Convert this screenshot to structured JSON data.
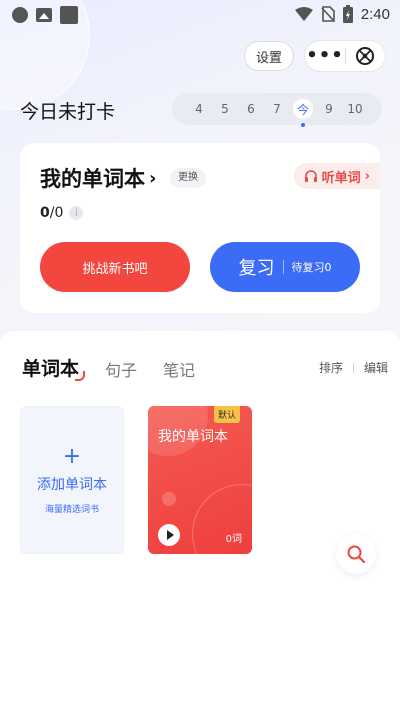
{
  "status_bar": {
    "time": "2:40",
    "left_icons": [
      "circle-icon",
      "image-icon",
      "square-icon"
    ],
    "right_icons": [
      "wifi-icon",
      "no-sim-icon",
      "battery-charging-icon"
    ]
  },
  "header": {
    "settings_label": "设置",
    "more_icon": "more-dots-icon",
    "close_icon": "close-circle-icon"
  },
  "checkin": {
    "title": "今日未打卡",
    "days": [
      "4",
      "5",
      "6",
      "7",
      "今",
      "9",
      "10"
    ],
    "today_index": 4
  },
  "wordbook_card": {
    "title": "我的单词本",
    "change_label": "更换",
    "listen_label": "听单词",
    "learned": "0",
    "total": "/0",
    "challenge_label": "挑战新书吧",
    "review_label": "复习",
    "review_pending": "待复习0"
  },
  "tabs": {
    "items": [
      "单词本",
      "句子",
      "笔记"
    ],
    "active_index": 0,
    "sort_label": "排序",
    "edit_label": "编辑"
  },
  "books": {
    "add_label": "添加单词本",
    "add_sub": "海量精选词书",
    "default_badge": "默认",
    "book_name": "我的单词本",
    "word_count": "0词"
  },
  "colors": {
    "accent_blue": "#3b6cf6",
    "accent_red": "#f2463f",
    "badge_yellow": "#f6c347"
  }
}
